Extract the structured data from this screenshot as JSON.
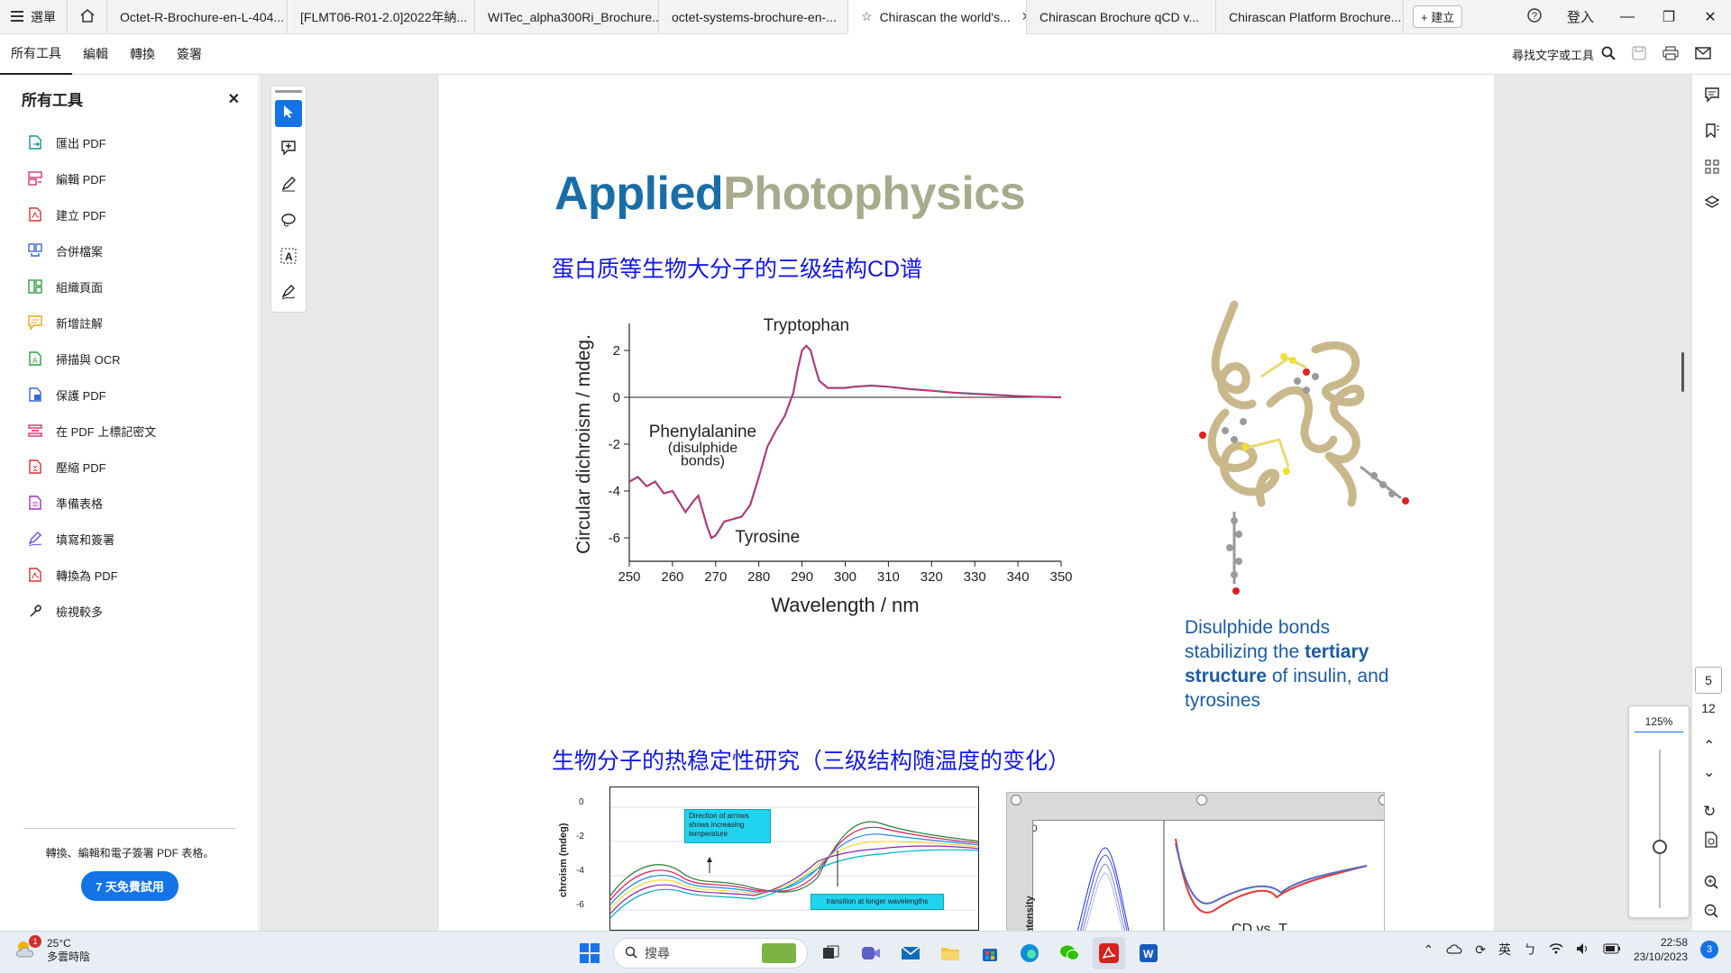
{
  "tabbar": {
    "menu_label": "選單",
    "tabs": [
      {
        "label": "Octet-R-Brochure-en-L-404..."
      },
      {
        "label": "[FLMT06-R01-2.0]2022年納..."
      },
      {
        "label": "WITec_alpha300Ri_Brochure..."
      },
      {
        "label": "octet-systems-brochure-en-..."
      },
      {
        "label": "Chirascan the world's..."
      },
      {
        "label": "Chirascan Brochure qCD v..."
      },
      {
        "label": "Chirascan Platform Brochure..."
      }
    ],
    "active_tab_index": 4,
    "new_label": "+ 建立",
    "signin_label": "登入"
  },
  "menubar": {
    "items": [
      {
        "label": "所有工具"
      },
      {
        "label": "編輯"
      },
      {
        "label": "轉換"
      },
      {
        "label": "簽署"
      }
    ],
    "search_label": "尋找文字或工具"
  },
  "leftpanel": {
    "title": "所有工具",
    "items": [
      {
        "label": "匯出 PDF",
        "icon": "export-pdf-icon",
        "color": "#1a8f8f"
      },
      {
        "label": "編輯 PDF",
        "icon": "edit-pdf-icon",
        "color": "#d6336c"
      },
      {
        "label": "建立 PDF",
        "icon": "create-pdf-icon",
        "color": "#d63232"
      },
      {
        "label": "合併檔案",
        "icon": "combine-files-icon",
        "color": "#3867d6"
      },
      {
        "label": "組織頁面",
        "icon": "organize-pages-icon",
        "color": "#2f9e44"
      },
      {
        "label": "新增註解",
        "icon": "add-comment-icon",
        "color": "#e8a90c"
      },
      {
        "label": "掃描與 OCR",
        "icon": "scan-ocr-icon",
        "color": "#2f9e44"
      },
      {
        "label": "保護 PDF",
        "icon": "protect-pdf-icon",
        "color": "#3867d6"
      },
      {
        "label": "在 PDF 上標記密文",
        "icon": "redact-icon",
        "color": "#d6336c"
      },
      {
        "label": "壓縮 PDF",
        "icon": "compress-pdf-icon",
        "color": "#d63232"
      },
      {
        "label": "準備表格",
        "icon": "prepare-form-icon",
        "color": "#9c36b5"
      },
      {
        "label": "填寫和簽署",
        "icon": "fill-sign-icon",
        "color": "#7048e8"
      },
      {
        "label": "轉換為 PDF",
        "icon": "convert-pdf-icon",
        "color": "#d63232"
      },
      {
        "label": "檢視較多",
        "icon": "more-tools-icon",
        "color": "#333333"
      }
    ],
    "footer_text": "轉換、編輯和電子簽署 PDF 表格。",
    "trial_button": "7 天免費試用"
  },
  "document": {
    "brand_part1": "Applied",
    "brand_part2": "Photophysics",
    "heading1": "蛋白质等生物大分子的三级结构CD谱",
    "heading2": "生物分子的热稳定性研究（三级结构随温度的变化）",
    "caption_line1": "Disulphide bonds stabilizing the",
    "caption_bold": "tertiary structure",
    "caption_line2": " of insulin, and tyrosines",
    "fig2_box1": "Direction of arrows shows increasing temperature",
    "fig2_box2": "transition at longer wavelengths",
    "fig2_ylabel": "chroism (mdeg)",
    "fig3_ylabel": "Intensity",
    "fig3_text": "CD vs. T"
  },
  "chart_data": [
    {
      "type": "line",
      "title": "",
      "xlabel": "Wavelength / nm",
      "ylabel": "Circular dichroism / mdeg.",
      "xlim": [
        250,
        350
      ],
      "ylim": [
        -7,
        3
      ],
      "x_ticks": [
        "250",
        "260",
        "270",
        "280",
        "290",
        "300",
        "310",
        "320",
        "330",
        "340",
        "350"
      ],
      "y_ticks": [
        "2",
        "0",
        "-2",
        "-4",
        "-6"
      ],
      "annotations": [
        "Tryptophan",
        "Phenylalanine",
        "(disulphide",
        "bonds)",
        "Tyrosine"
      ],
      "series": [
        {
          "x": [
            250,
            252,
            254,
            256,
            258,
            260,
            262,
            263,
            265,
            266,
            268,
            269,
            270,
            272,
            274,
            276,
            278,
            280,
            282,
            284,
            286,
            288,
            289,
            290,
            291,
            292,
            293,
            294,
            296,
            298,
            300,
            302,
            306,
            310,
            315,
            320,
            325,
            330,
            335,
            340,
            345,
            350
          ],
          "y": [
            -3.6,
            -3.4,
            -3.8,
            -3.6,
            -4.1,
            -4.0,
            -4.6,
            -4.9,
            -4.4,
            -4.2,
            -5.5,
            -6.0,
            -5.9,
            -5.3,
            -5.2,
            -5.1,
            -4.6,
            -3.4,
            -2.1,
            -1.4,
            -0.8,
            0.2,
            1.2,
            2.0,
            2.2,
            2.0,
            1.3,
            0.7,
            0.4,
            0.4,
            0.4,
            0.45,
            0.5,
            0.45,
            0.35,
            0.28,
            0.2,
            0.15,
            0.1,
            0.05,
            0.02,
            0.0
          ]
        }
      ]
    },
    {
      "type": "line",
      "title": "",
      "ylabel": "chroism (mdeg)",
      "y_ticks": [
        "0",
        "-2",
        "-4",
        "-6"
      ],
      "annotations": [
        "Direction of arrows shows increasing temperature",
        "transition at longer wavelengths"
      ]
    }
  ],
  "rightrail": {
    "page_current": "5",
    "page_total": "12",
    "zoom": "125%"
  },
  "taskbar": {
    "temp": "25°C",
    "weather": "多雲時陰",
    "weather_badge": "1",
    "search_placeholder": "搜尋",
    "ime": "英",
    "time": "22:58",
    "date": "23/10/2023",
    "notif_count": "3"
  }
}
